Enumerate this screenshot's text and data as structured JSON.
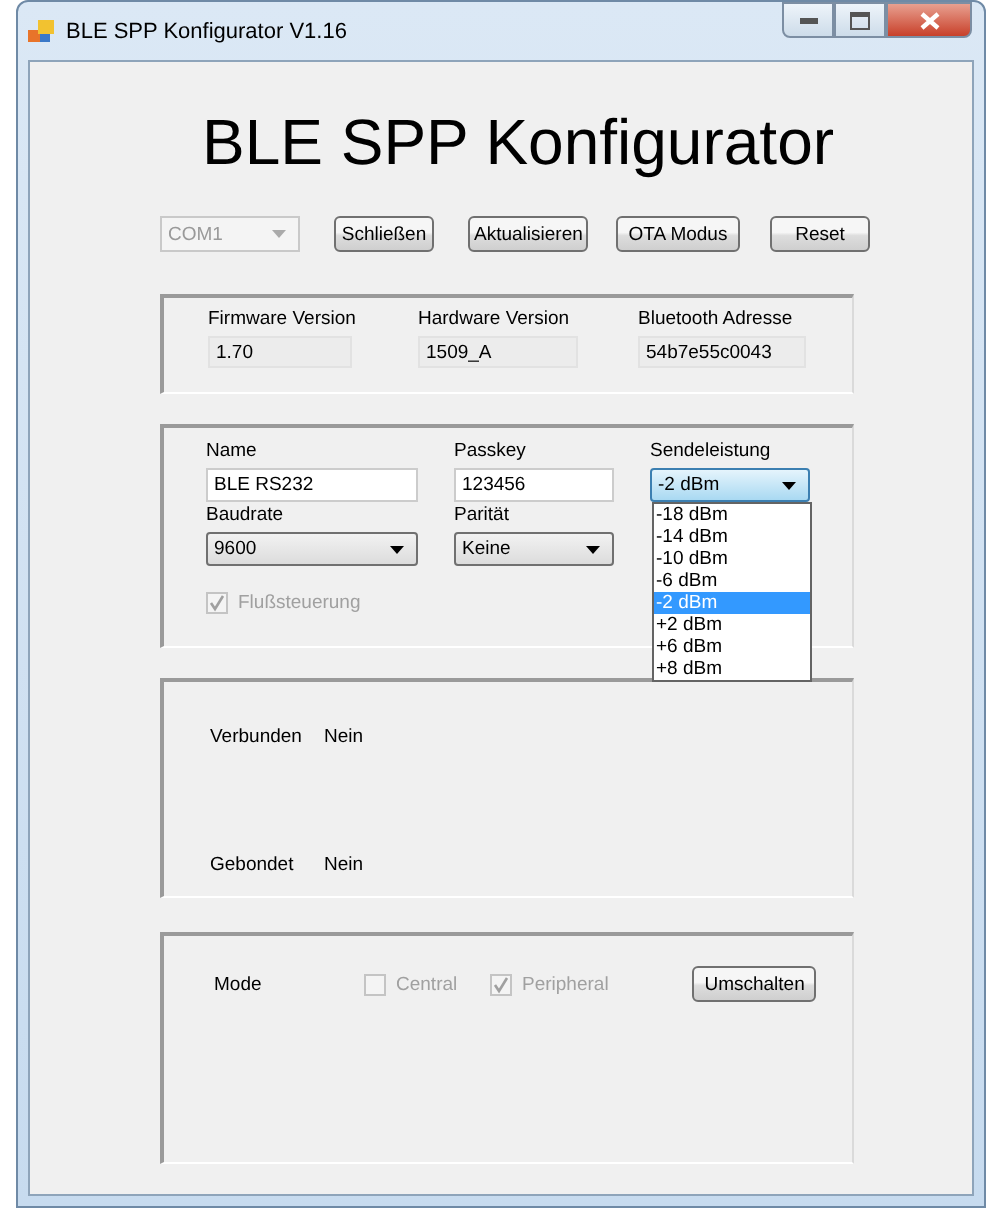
{
  "window": {
    "title": "BLE SPP Konfigurator V1.16"
  },
  "heading": "BLE SPP Konfigurator",
  "port": {
    "value": "COM1",
    "disabled": true
  },
  "toolbar_buttons": [
    "Schließen",
    "Aktualisieren",
    "OTA Modus",
    "Reset"
  ],
  "info": [
    {
      "label": "Firmware Version",
      "value": "1.70"
    },
    {
      "label": "Hardware Version",
      "value": "1509_A"
    },
    {
      "label": "Bluetooth Adresse",
      "value": "54b7e55c0043"
    }
  ],
  "settings": {
    "name": {
      "label": "Name",
      "value": "BLE RS232"
    },
    "passkey": {
      "label": "Passkey",
      "value": "123456"
    },
    "sendeleistung": {
      "label": "Sendeleistung",
      "value": "-2 dBm",
      "expanded": true,
      "options": [
        {
          "label": "-18 dBm",
          "selected": false
        },
        {
          "label": "-14 dBm",
          "selected": false
        },
        {
          "label": "-10 dBm",
          "selected": false
        },
        {
          "label": "-6 dBm",
          "selected": false
        },
        {
          "label": "-2 dBm",
          "selected": true
        },
        {
          "label": "+2 dBm",
          "selected": false
        },
        {
          "label": "+6 dBm",
          "selected": false
        },
        {
          "label": "+8 dBm",
          "selected": false
        }
      ]
    },
    "baudrate": {
      "label": "Baudrate",
      "value": "9600"
    },
    "paritaet": {
      "label": "Parität",
      "value": "Keine"
    },
    "flow_control": {
      "label": "Flußsteuerung",
      "checked": true,
      "disabled": true
    }
  },
  "status": [
    {
      "label": "Verbunden",
      "value": "Nein"
    },
    {
      "label": "Gebondet",
      "value": "Nein"
    }
  ],
  "mode": {
    "label": "Mode",
    "disabled": true,
    "options": [
      {
        "label": "Central",
        "checked": false
      },
      {
        "label": "Peripheral",
        "checked": true
      }
    ],
    "button": "Umschalten"
  }
}
